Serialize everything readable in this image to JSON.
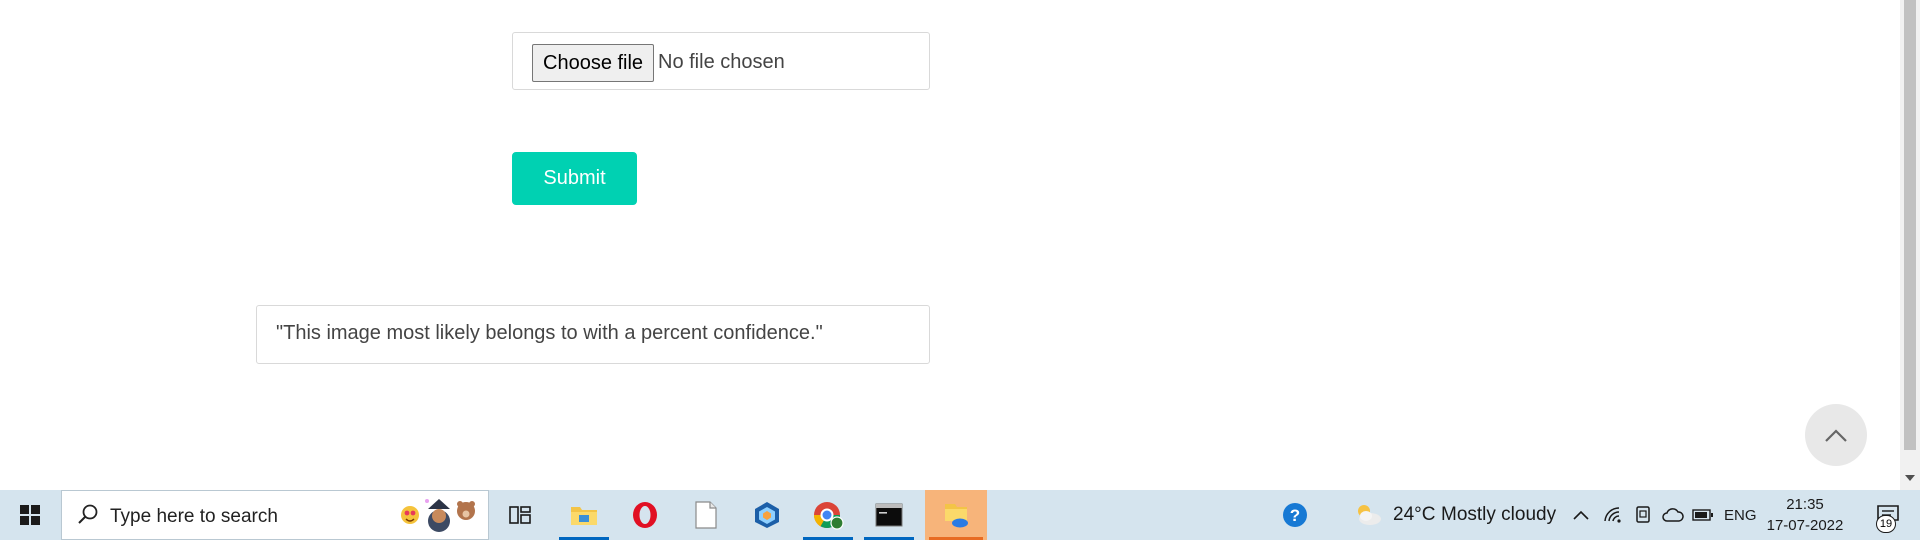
{
  "form": {
    "choose_file_label": "Choose file",
    "file_status": "No file chosen",
    "submit_label": "Submit",
    "result_text": "\"This image most likely belongs to with a percent confidence.\""
  },
  "taskbar": {
    "search_placeholder": "Type here to search",
    "weather": {
      "temp": "24°C",
      "condition": "Mostly cloudy"
    },
    "language": "ENG",
    "time": "21:35",
    "date": "17-07-2022",
    "notification_count": "19",
    "apps": [
      {
        "name": "file-explorer-icon"
      },
      {
        "name": "opera-icon"
      },
      {
        "name": "notepad-icon"
      },
      {
        "name": "virtualbox-icon"
      },
      {
        "name": "chrome-icon"
      },
      {
        "name": "terminal-icon"
      },
      {
        "name": "file-manager-cloud-icon"
      }
    ]
  },
  "colors": {
    "submit": "#00d1b2",
    "taskbar": "#d5e4ee",
    "highlight": "#f7b47a"
  }
}
